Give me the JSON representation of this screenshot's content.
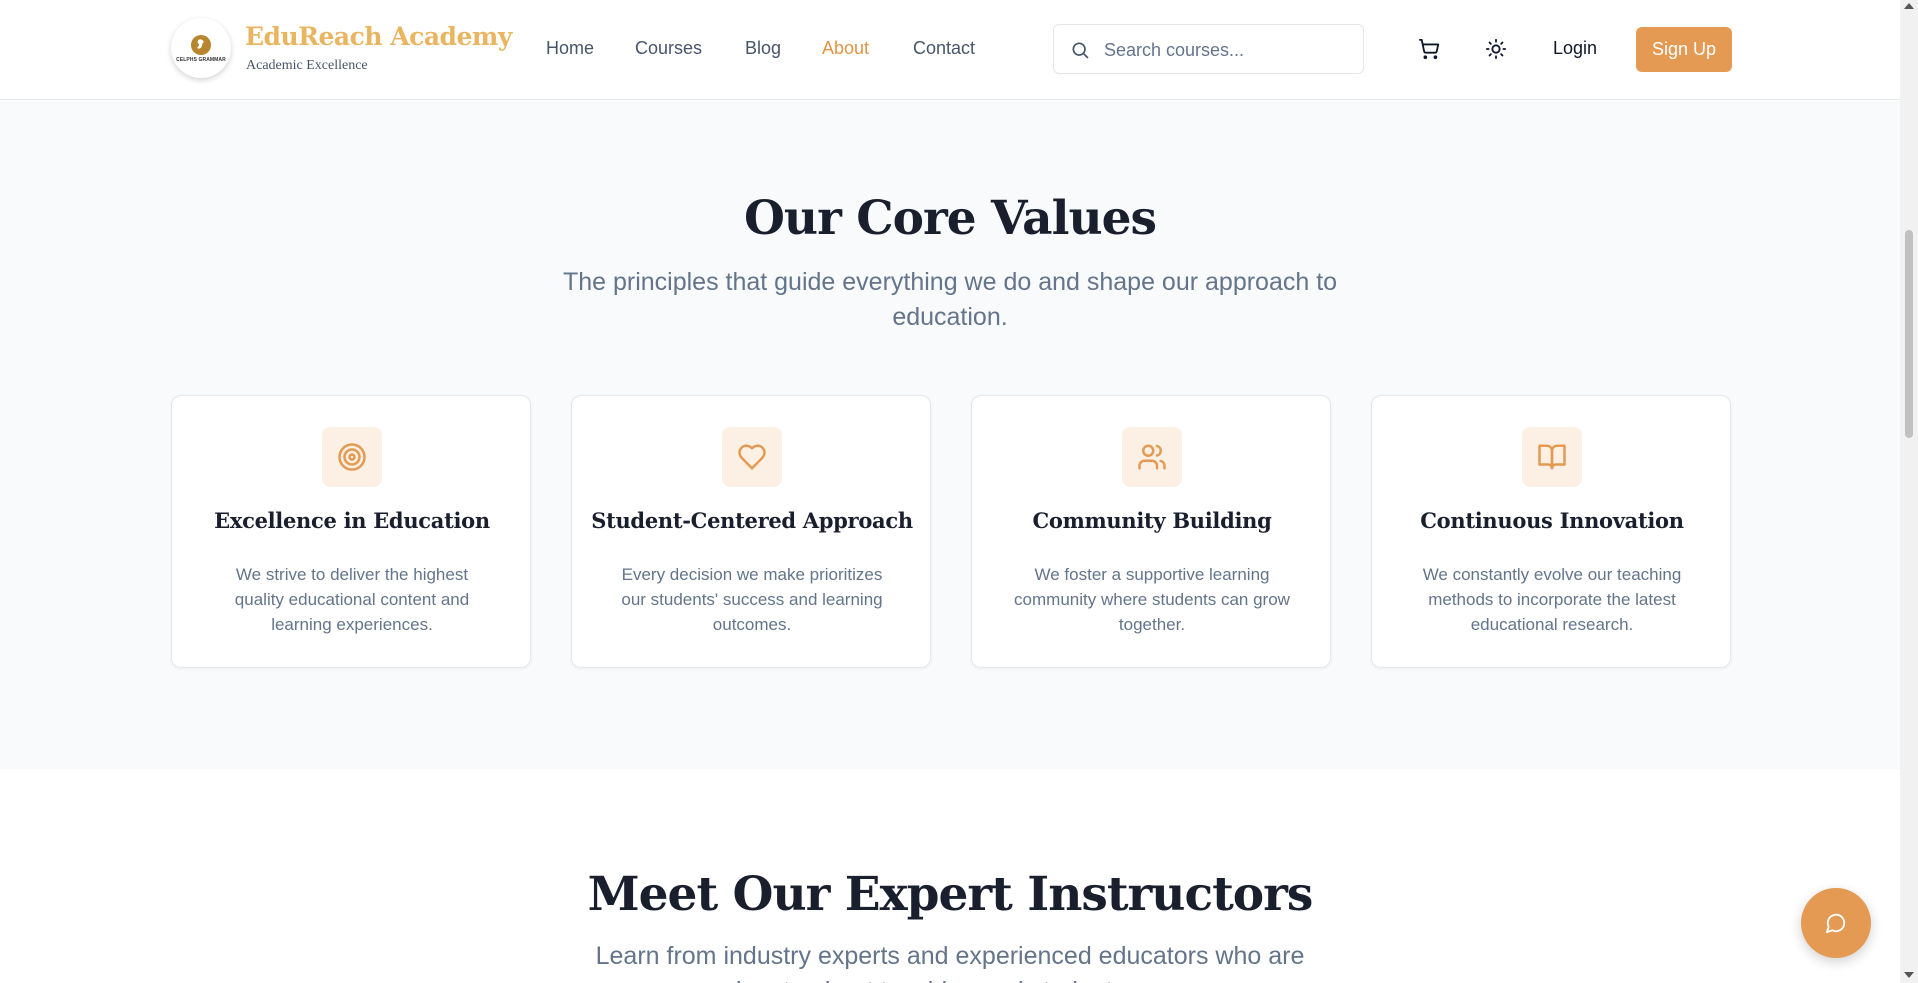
{
  "brand": {
    "name": "EduReach Academy",
    "tagline": "Academic Excellence",
    "logo_text": "CELPHS GRAMMAR"
  },
  "nav": {
    "items": [
      "Home",
      "Courses",
      "Blog",
      "About",
      "Contact"
    ],
    "active": "About"
  },
  "search": {
    "placeholder": "Search courses...",
    "value": ""
  },
  "header_actions": {
    "login_label": "Login",
    "signup_label": "Sign Up",
    "cart_icon": "cart-icon",
    "theme_icon": "sun-icon"
  },
  "core_values": {
    "title": "Our Core Values",
    "subtitle_line1": "The principles that guide everything we do and shape our approach to",
    "subtitle_line2": "education.",
    "cards": [
      {
        "icon": "target-icon",
        "title": "Excellence in Education",
        "description": "We strive to deliver the highest quality educational content and learning experiences."
      },
      {
        "icon": "heart-icon",
        "title": "Student-Centered Approach",
        "description": "Every decision we make prioritizes our students' success and learning outcomes."
      },
      {
        "icon": "users-icon",
        "title": "Community Building",
        "description": "We foster a supportive learning community where students can grow together."
      },
      {
        "icon": "book-open-icon",
        "title": "Continuous Innovation",
        "description": "We constantly evolve our teaching methods to incorporate the latest educational research."
      }
    ]
  },
  "instructors": {
    "title": "Meet Our Expert Instructors",
    "subtitle_line1": "Learn from industry experts and experienced educators who are",
    "subtitle_line2": "passionate about teaching and student success."
  },
  "chat": {
    "icon": "message-circle-icon"
  },
  "colors": {
    "accent": "#e49a52",
    "brand_gold": "#e9b560",
    "heading": "#1a1f2e",
    "muted": "#64748b",
    "icon_bg": "#fcefe4"
  }
}
